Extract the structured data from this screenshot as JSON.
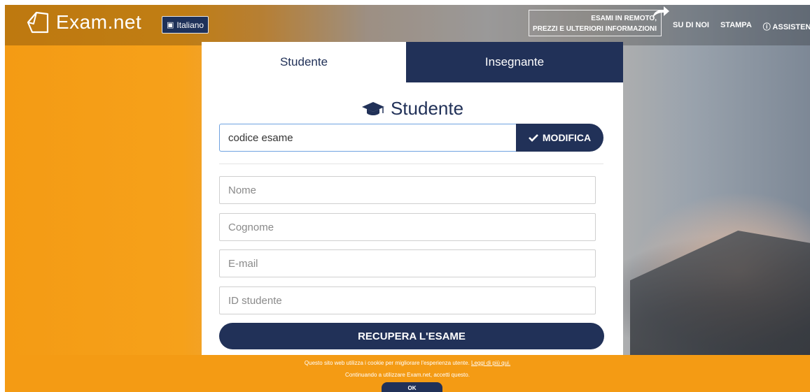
{
  "header": {
    "logo_text": "Exam.net",
    "language_label": "Italiano",
    "remote_line1": "ESAMI IN REMOTO,",
    "remote_line2": "PREZZI E ULTERIORI INFORMAZIONI",
    "nav": [
      "SU DI NOI",
      "STAMPA",
      "ⓘ ASSISTENZA"
    ]
  },
  "tabs": {
    "student": "Studente",
    "teacher": "Insegnante"
  },
  "form": {
    "heading": "Studente",
    "exam_code_value": "codice esame",
    "modify_label": "MODIFICA",
    "first_name_placeholder": "Nome",
    "last_name_placeholder": "Cognome",
    "email_placeholder": "E-mail",
    "student_id_placeholder": "ID studente",
    "submit_label": "RECUPERA L'ESAME"
  },
  "cookie": {
    "line1": "Questo sito web utilizza i cookie per migliorare l'esperienza utente.",
    "link": "Leggi di più qui.",
    "line2": "Continuando a utilizzare Exam.net, accetti questo.",
    "ok_label": "OK"
  },
  "colors": {
    "navy": "#213158",
    "orange": "#f49b14"
  }
}
